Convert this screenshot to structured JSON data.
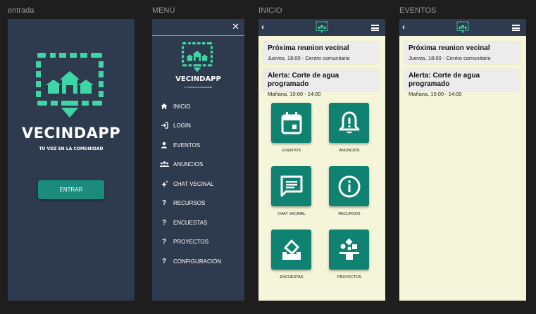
{
  "frames": {
    "entrada": "entrada",
    "menu": "MENÚ",
    "inicio": "INICIO",
    "eventos": "EVENTOS"
  },
  "brand": {
    "name": "VECINDAPP",
    "tagline": "TU VOZ EN LA COMUNIDAD",
    "accent": "#3ed6a6",
    "dark": "#2e3a4d",
    "teal": "#0f8271",
    "cream": "#f5f5d9"
  },
  "entrada": {
    "enter_label": "ENTRAR"
  },
  "menu": {
    "close": "✕",
    "items": [
      {
        "label": "INICIO",
        "icon": "home-icon"
      },
      {
        "label": "LOGIN",
        "icon": "login-icon"
      },
      {
        "label": "EVENTOS",
        "icon": "person-icon"
      },
      {
        "label": "ANUNCIOS",
        "icon": "group-icon"
      },
      {
        "label": "CHAT VECINAL",
        "icon": "sparkle-icon"
      },
      {
        "label": "RECURSOS",
        "icon": "question-icon",
        "glyph": "?"
      },
      {
        "label": "ENCUESTAS",
        "icon": "question-icon",
        "glyph": "?"
      },
      {
        "label": "PROYECTOS",
        "icon": "question-icon",
        "glyph": "?"
      },
      {
        "label": "CONFIGURACIÓN",
        "icon": "question-icon",
        "glyph": "?"
      }
    ]
  },
  "inicio": {
    "back": "‹",
    "cards": [
      {
        "title": "Próxima reunion vecinal",
        "sub": "Jueves, 18:00 - Centro comunitario"
      },
      {
        "title": "Alerta: Corte de agua programado",
        "sub": "Mañana, 10:00 - 14:00"
      }
    ],
    "tiles": [
      {
        "label": "EVENTOS",
        "icon": "calendar-icon"
      },
      {
        "label": "ANUNCIOS",
        "icon": "bell-alert-icon"
      },
      {
        "label": "CHAT VECINAL",
        "icon": "chat-icon"
      },
      {
        "label": "RECURSOS",
        "icon": "info-icon"
      },
      {
        "label": "ENCUESTAS",
        "icon": "ballot-icon"
      },
      {
        "label": "PROYECTOS",
        "icon": "project-icon"
      }
    ]
  },
  "eventos": {
    "back": "‹",
    "cards": [
      {
        "title": "Próxima reunion vecinal",
        "sub": "Jueves, 18:00 - Centro comunitario"
      },
      {
        "title": "Alerta: Corte de agua programado",
        "sub": "Mañana, 10:00 - 14:00"
      }
    ]
  }
}
